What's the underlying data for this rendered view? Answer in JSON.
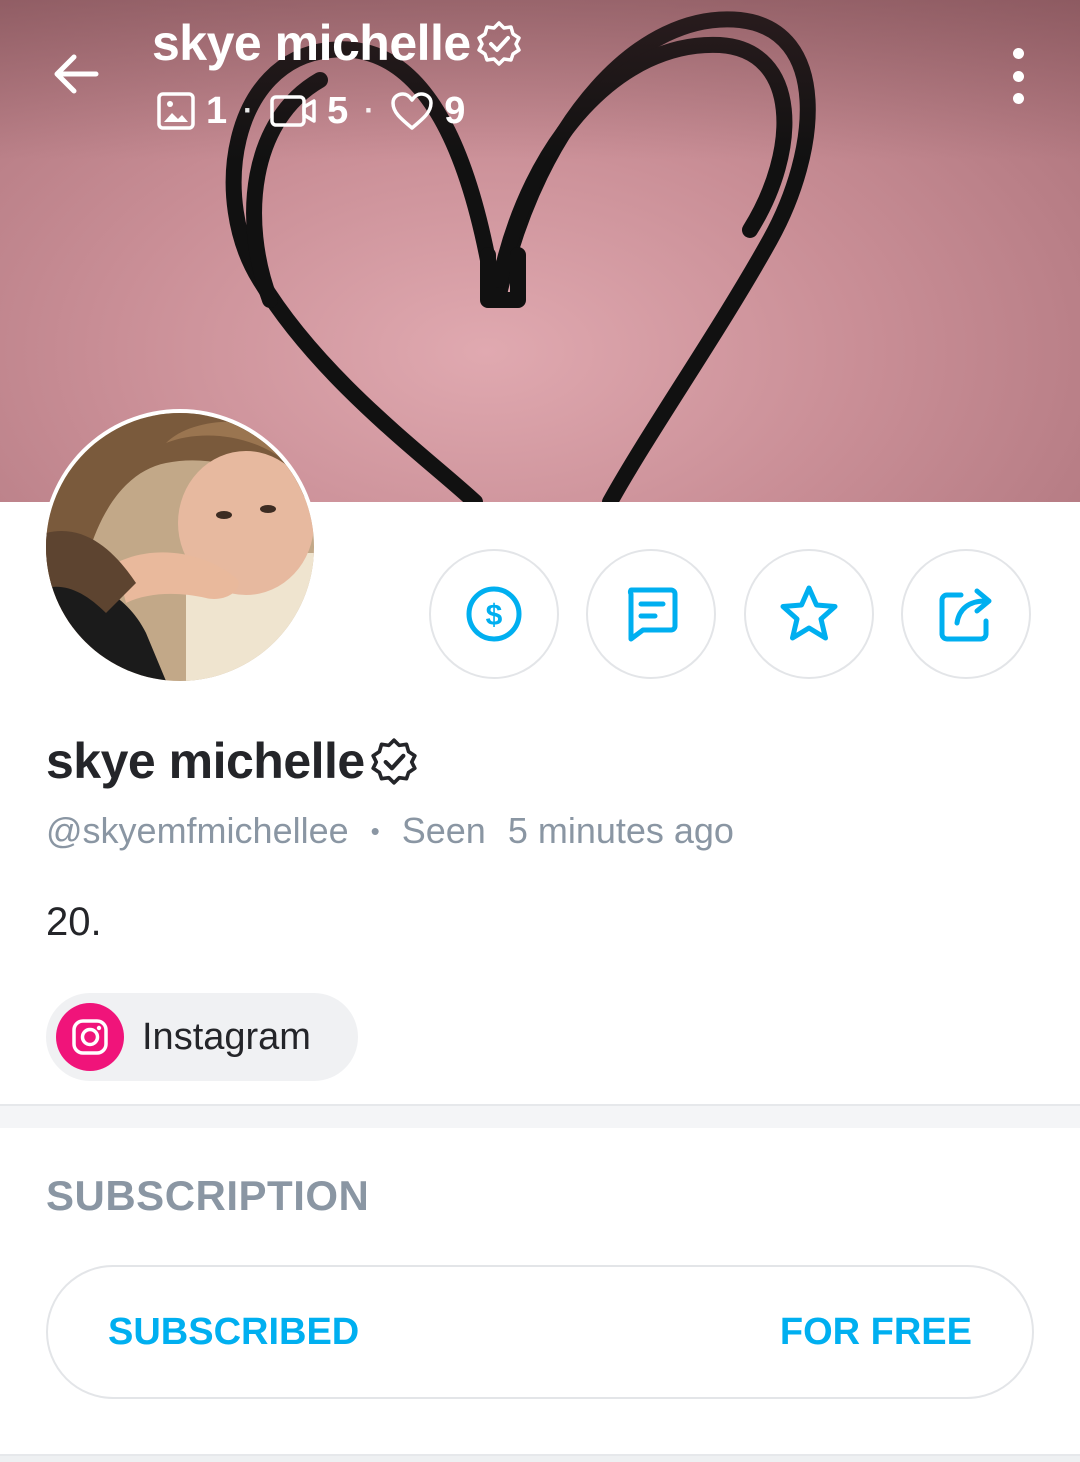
{
  "header": {
    "name": "skye michelle",
    "stats": {
      "photos": "1",
      "videos": "5",
      "likes": "9",
      "separator": "·"
    }
  },
  "profile": {
    "name": "skye michelle",
    "handle": "@skyemfmichellee",
    "separator": "•",
    "seen_label": "Seen",
    "seen_time": "5 minutes ago",
    "bio": "20."
  },
  "social": {
    "instagram_label": "Instagram"
  },
  "subscription": {
    "section_title": "SUBSCRIPTION",
    "status_label": "SUBSCRIBED",
    "price_label": "FOR FREE"
  },
  "colors": {
    "accent": "#00aff0",
    "muted_text": "#8a96a3",
    "instagram": "#f0147a",
    "cover": "#c98e96"
  },
  "icons": {
    "back": "arrow-left-icon",
    "verified": "verified-badge-icon",
    "photo": "image-icon",
    "video": "video-camera-icon",
    "likes": "heart-icon",
    "more": "more-vertical-icon",
    "tip": "dollar-circle-icon",
    "message": "message-icon",
    "favorite": "star-icon",
    "share": "share-icon",
    "instagram": "instagram-icon"
  }
}
